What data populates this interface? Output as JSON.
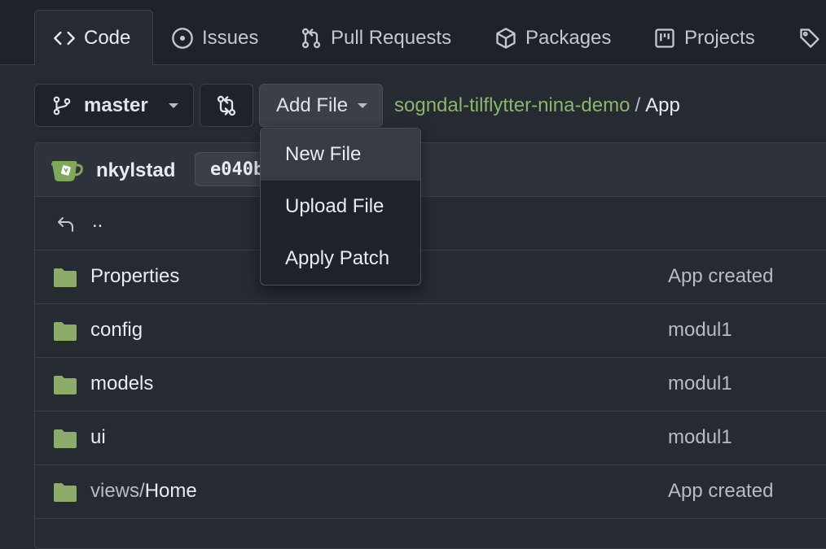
{
  "tabs": [
    {
      "label": "Code",
      "icon": "code-icon",
      "active": true
    },
    {
      "label": "Issues",
      "icon": "issue-icon"
    },
    {
      "label": "Pull Requests",
      "icon": "pull-request-icon"
    },
    {
      "label": "Packages",
      "icon": "package-icon"
    },
    {
      "label": "Projects",
      "icon": "project-icon"
    },
    {
      "label": "",
      "icon": "tag-icon"
    }
  ],
  "toolbar": {
    "branch": "master",
    "add_file": "Add File"
  },
  "breadcrumb": {
    "repo": "sogndal-tilflytter-nina-demo",
    "separator": "/",
    "path": "App"
  },
  "commit": {
    "author": "nkylstad",
    "sha": "e040b"
  },
  "dropdown": {
    "items": [
      "New File",
      "Upload File",
      "Apply Patch"
    ]
  },
  "files": {
    "parent": "..",
    "rows": [
      {
        "name_prefix": "",
        "name": "Properties",
        "message": "App created"
      },
      {
        "name_prefix": "",
        "name": "config",
        "message": "modul1"
      },
      {
        "name_prefix": "",
        "name": "models",
        "message": "modul1"
      },
      {
        "name_prefix": "",
        "name": "ui",
        "message": "modul1"
      },
      {
        "name_prefix": "views/",
        "name": "Home",
        "message": "App created"
      }
    ]
  },
  "colors": {
    "background": "#262a31",
    "repo_link": "#8cb56d",
    "folder": "#8cab6b"
  }
}
